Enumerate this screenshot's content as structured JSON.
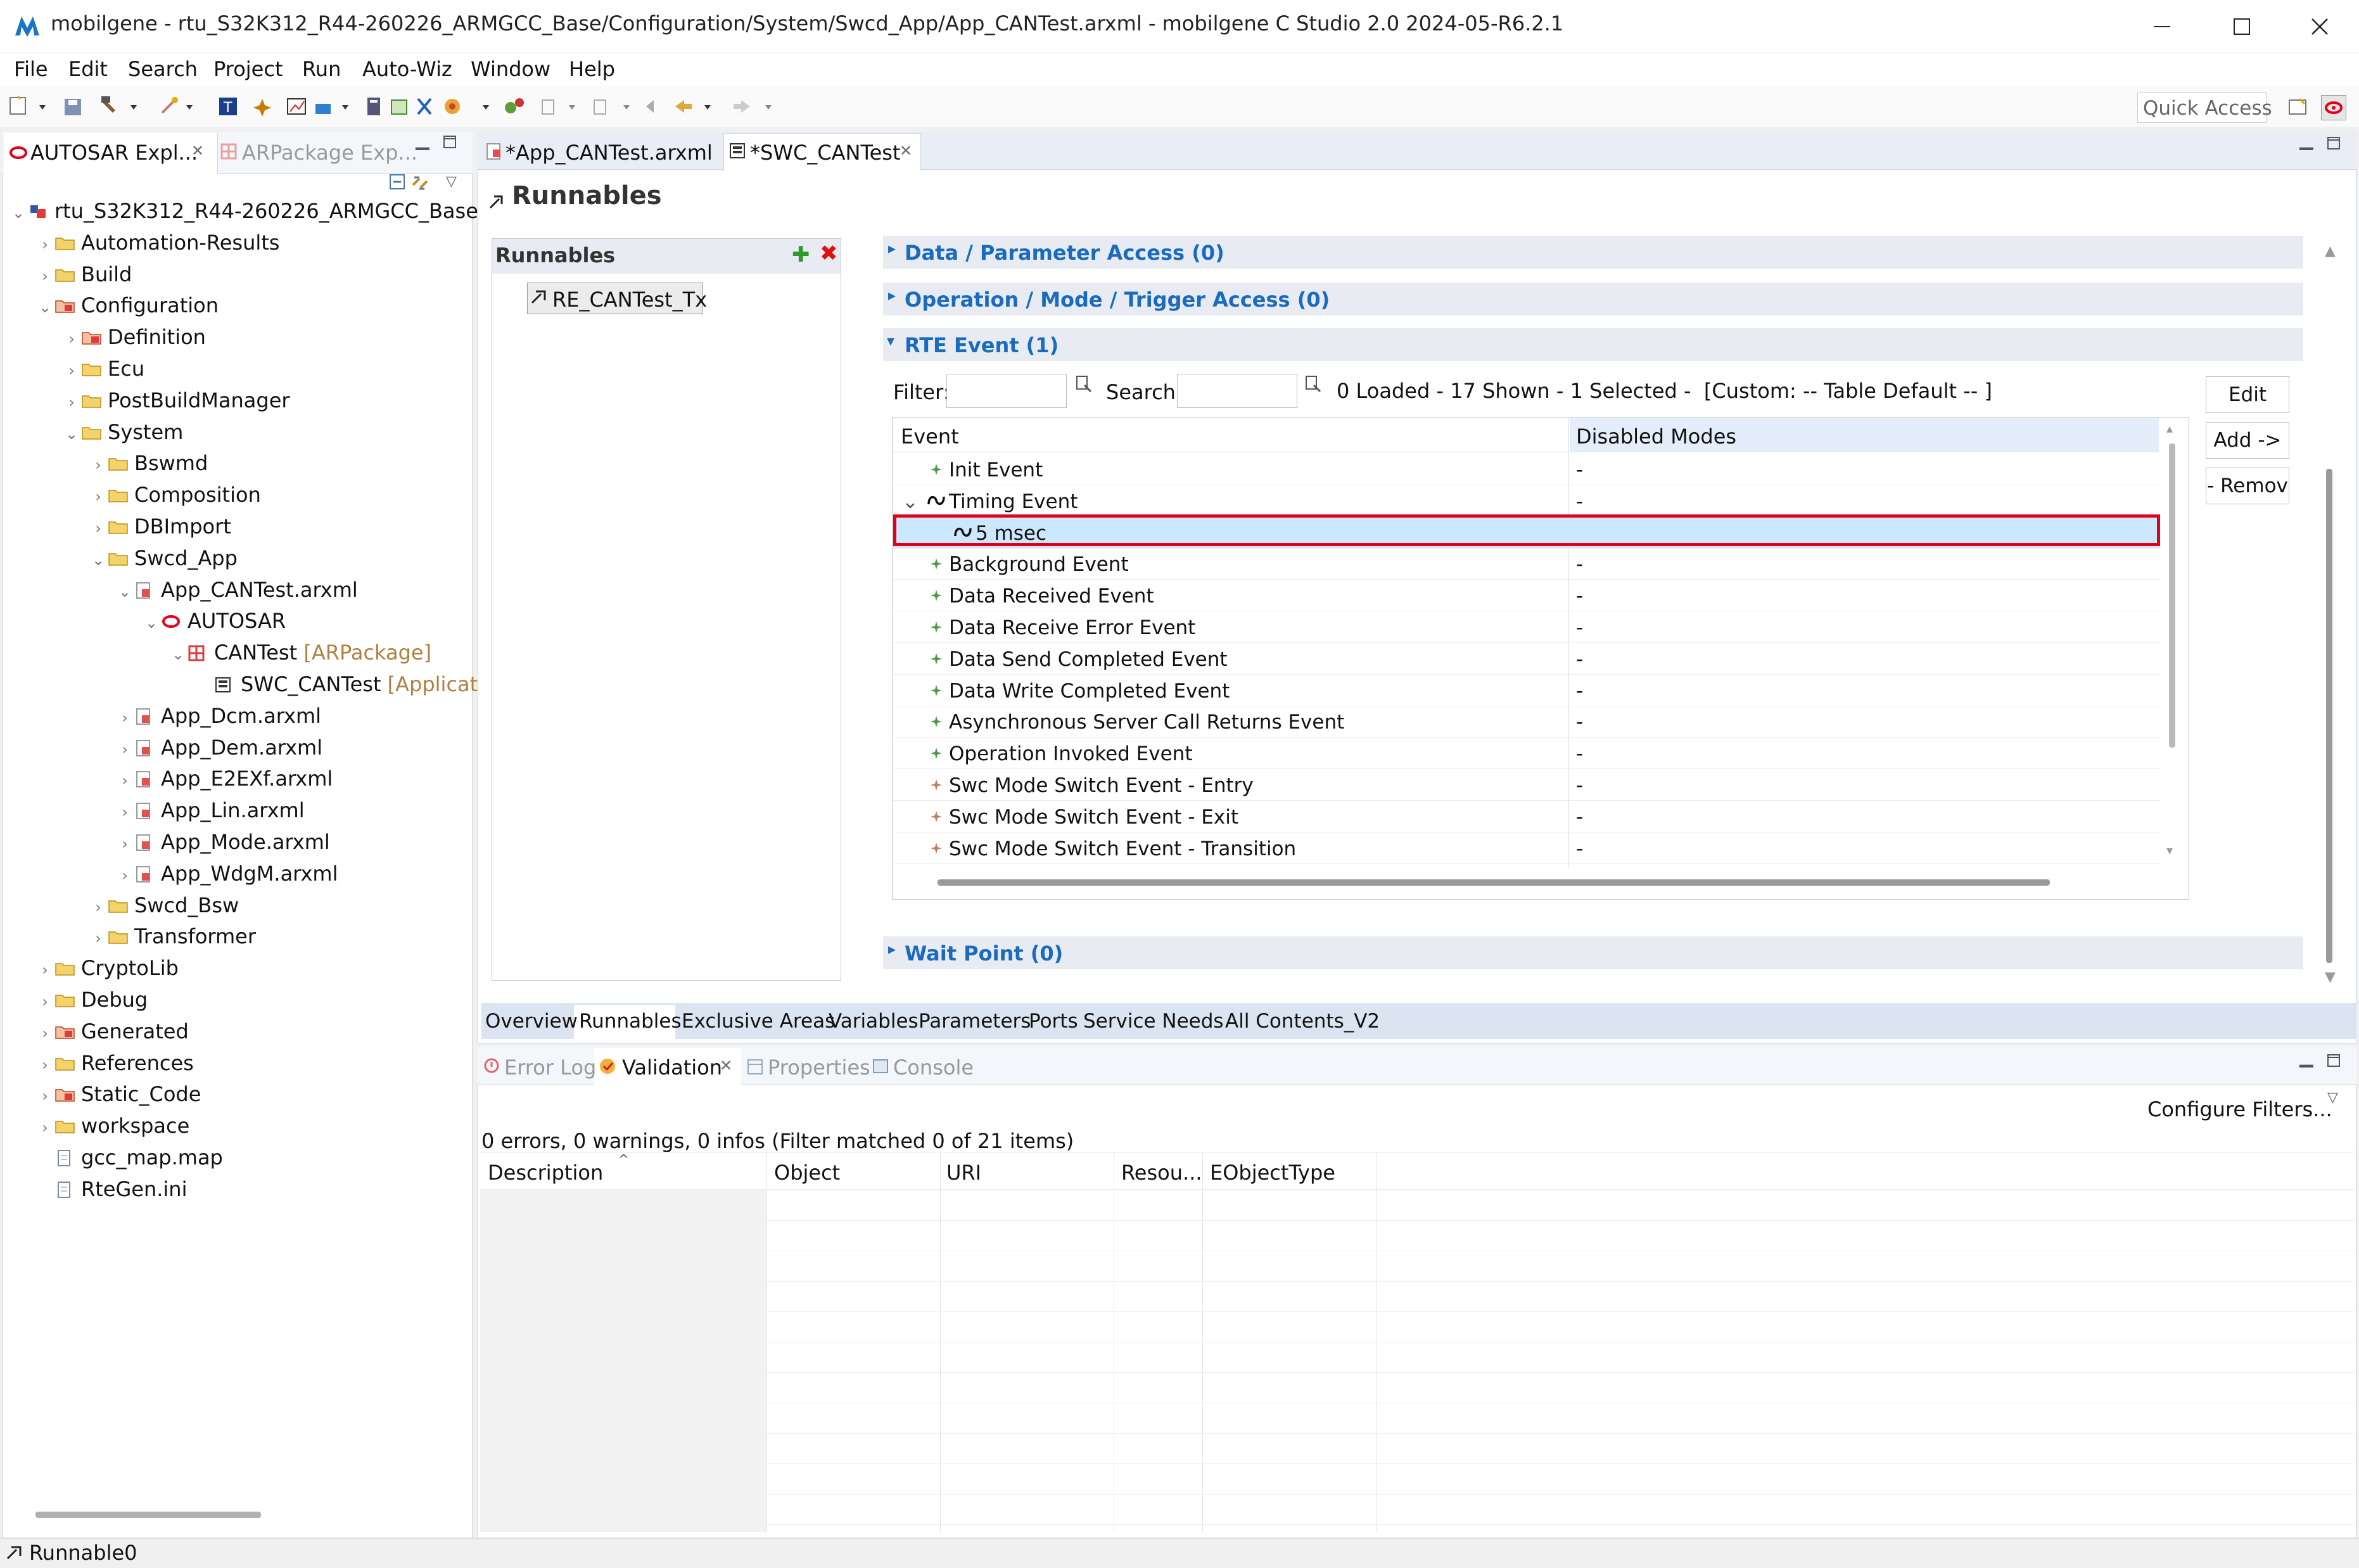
{
  "window": {
    "title": "mobilgene - rtu_S32K312_R44-260226_ARMGCC_Base/Configuration/System/Swcd_App/App_CANTest.arxml - mobilgene C Studio 2.0 2024-05-R6.2.1",
    "controls": [
      "minimize",
      "maximize",
      "close"
    ]
  },
  "menu": [
    "File",
    "Edit",
    "Search",
    "Project",
    "Run",
    "Auto-Wiz",
    "Window",
    "Help"
  ],
  "toolbar": {
    "quick_access": "Quick Access"
  },
  "left": {
    "tabs": [
      "AUTOSAR Expl...",
      "ARPackage Exp..."
    ],
    "tree": [
      {
        "label": "rtu_S32K312_R44-260226_ARMGCC_Base",
        "level": 0,
        "exp": "v"
      },
      {
        "label": "Automation-Results",
        "level": 1,
        "exp": ">"
      },
      {
        "label": "Build",
        "level": 1,
        "exp": ">"
      },
      {
        "label": "Configuration",
        "level": 1,
        "exp": "v"
      },
      {
        "label": "Definition",
        "level": 2,
        "exp": ">"
      },
      {
        "label": "Ecu",
        "level": 2,
        "exp": ">"
      },
      {
        "label": "PostBuildManager",
        "level": 2,
        "exp": ">"
      },
      {
        "label": "System",
        "level": 2,
        "exp": "v"
      },
      {
        "label": "Bswmd",
        "level": 3,
        "exp": ">"
      },
      {
        "label": "Composition",
        "level": 3,
        "exp": ">"
      },
      {
        "label": "DBImport",
        "level": 3,
        "exp": ">"
      },
      {
        "label": "Swcd_App",
        "level": 3,
        "exp": "v"
      },
      {
        "label": "App_CANTest.arxml",
        "level": 4,
        "exp": "v"
      },
      {
        "label": "AUTOSAR",
        "level": 5,
        "exp": "v"
      },
      {
        "label": "CANTest",
        "suffix": " [ARPackage]",
        "level": 6,
        "exp": "v"
      },
      {
        "label": "SWC_CANTest",
        "suffix": " [Applicat",
        "level": 7,
        "exp": ""
      },
      {
        "label": "App_Dcm.arxml",
        "level": 4,
        "exp": ">"
      },
      {
        "label": "App_Dem.arxml",
        "level": 4,
        "exp": ">"
      },
      {
        "label": "App_E2EXf.arxml",
        "level": 4,
        "exp": ">"
      },
      {
        "label": "App_Lin.arxml",
        "level": 4,
        "exp": ">"
      },
      {
        "label": "App_Mode.arxml",
        "level": 4,
        "exp": ">"
      },
      {
        "label": "App_WdgM.arxml",
        "level": 4,
        "exp": ">"
      },
      {
        "label": "Swcd_Bsw",
        "level": 3,
        "exp": ">"
      },
      {
        "label": "Transformer",
        "level": 3,
        "exp": ">"
      },
      {
        "label": "CryptoLib",
        "level": 1,
        "exp": ">"
      },
      {
        "label": "Debug",
        "level": 1,
        "exp": ">"
      },
      {
        "label": "Generated",
        "level": 1,
        "exp": ">"
      },
      {
        "label": "References",
        "level": 1,
        "exp": ">"
      },
      {
        "label": "Static_Code",
        "level": 1,
        "exp": ">"
      },
      {
        "label": "workspace",
        "level": 1,
        "exp": ">"
      },
      {
        "label": "gcc_map.map",
        "level": 1,
        "exp": ""
      },
      {
        "label": "RteGen.ini",
        "level": 1,
        "exp": ""
      }
    ]
  },
  "editor": {
    "tabs": [
      "*App_CANTest.arxml",
      "*SWC_CANTest"
    ],
    "title": "Runnables",
    "runnables_label": "Runnables",
    "runnable_item": "RE_CANTest_Tx",
    "sections": {
      "data": "Data / Parameter Access (0)",
      "operation": "Operation / Mode / Trigger Access (0)",
      "rte": "RTE Event (1)",
      "wait": "Wait Point (0)"
    },
    "filter_label": "Filter:",
    "search_label": "Search:",
    "status": "0 Loaded - 17 Shown - 1 Selected -  [Custom: -- Table Default -- ]",
    "columns": [
      "Event",
      "Disabled Modes"
    ],
    "rows": [
      {
        "event": "Init Event",
        "modes": "-",
        "indent": 0,
        "exp": ""
      },
      {
        "event": "Timing Event",
        "modes": "-",
        "indent": 0,
        "exp": "v"
      },
      {
        "event": "5 msec",
        "modes": "",
        "indent": 1,
        "exp": "",
        "selected": true
      },
      {
        "event": "Background Event",
        "modes": "-",
        "indent": 0,
        "exp": ""
      },
      {
        "event": "Data Received Event",
        "modes": "-",
        "indent": 0,
        "exp": ""
      },
      {
        "event": "Data Receive Error Event",
        "modes": "-",
        "indent": 0,
        "exp": ""
      },
      {
        "event": "Data Send Completed Event",
        "modes": "-",
        "indent": 0,
        "exp": ""
      },
      {
        "event": "Data Write Completed Event",
        "modes": "-",
        "indent": 0,
        "exp": ""
      },
      {
        "event": "Asynchronous Server Call Returns Event",
        "modes": "-",
        "indent": 0,
        "exp": ""
      },
      {
        "event": "Operation Invoked Event",
        "modes": "-",
        "indent": 0,
        "exp": ""
      },
      {
        "event": "Swc Mode Switch Event - Entry",
        "modes": "-",
        "indent": 0,
        "exp": ""
      },
      {
        "event": "Swc Mode Switch Event - Exit",
        "modes": "-",
        "indent": 0,
        "exp": ""
      },
      {
        "event": "Swc Mode Switch Event - Transition",
        "modes": "-",
        "indent": 0,
        "exp": ""
      }
    ],
    "buttons": {
      "edit": "Edit",
      "add": "Add ->",
      "remove": "- Remov"
    },
    "bottom_tabs": [
      "Overview",
      "Runnables",
      "Exclusive Areas",
      "Variables",
      "Parameters",
      "Ports",
      "Service Needs",
      "All Contents_V2"
    ]
  },
  "problems": {
    "tabs": [
      "Error Log",
      "Validation",
      "Properties",
      "Console"
    ],
    "configure": "Configure Filters...",
    "summary": "0 errors, 0 warnings, 0 infos (Filter matched 0 of 21 items)",
    "columns": [
      "Description",
      "Object",
      "URI",
      "Resou...",
      "EObjectType"
    ]
  },
  "status": {
    "text": "Runnable0"
  },
  "colors": {
    "accent": "#1a6bbf",
    "highlight": "#e3001b",
    "selection": "#cce8ff"
  }
}
